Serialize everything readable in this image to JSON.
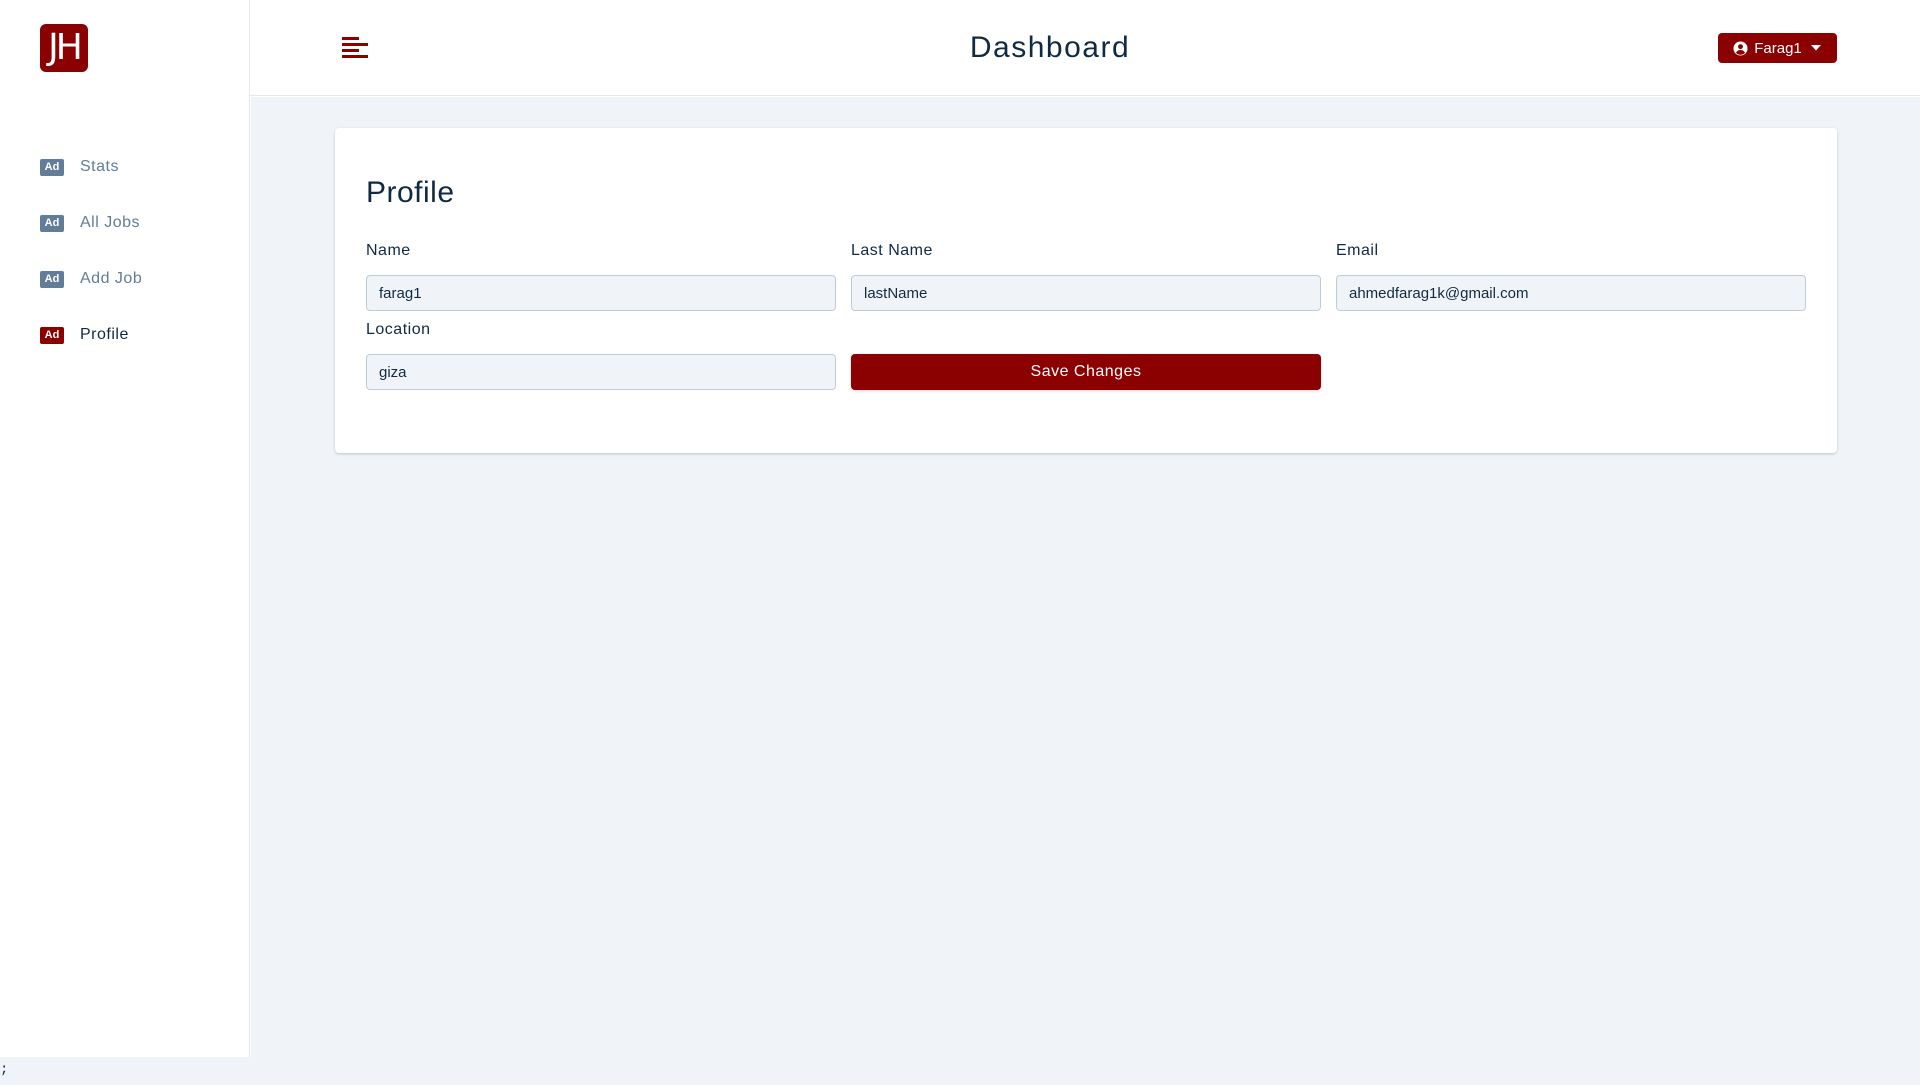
{
  "logo": {
    "text": "JH"
  },
  "sidebar": {
    "items": [
      {
        "icon_text": "Ad",
        "label": "Stats",
        "active": false
      },
      {
        "icon_text": "Ad",
        "label": "All Jobs",
        "active": false
      },
      {
        "icon_text": "Ad",
        "label": "Add Job",
        "active": false
      },
      {
        "icon_text": "Ad",
        "label": "Profile",
        "active": true
      }
    ]
  },
  "header": {
    "title": "Dashboard",
    "menu_icon": "hamburger-menu-icon",
    "user": {
      "name": "Farag1",
      "icon": "user-circle-icon",
      "caret_icon": "caret-down-icon"
    }
  },
  "profile": {
    "title": "Profile",
    "fields": {
      "name": {
        "label": "Name",
        "value": "farag1"
      },
      "last_name": {
        "label": "Last Name",
        "value": "lastName"
      },
      "email": {
        "label": "Email",
        "value": "ahmedfarag1k@gmail.com"
      },
      "location": {
        "label": "Location",
        "value": "giza"
      }
    },
    "save_label": "Save Changes"
  },
  "footer": {
    "stray_text": ";"
  },
  "colors": {
    "accent": "#8b0000",
    "background": "#f0f4f8",
    "text": "#102a43",
    "muted": "#627d98"
  }
}
